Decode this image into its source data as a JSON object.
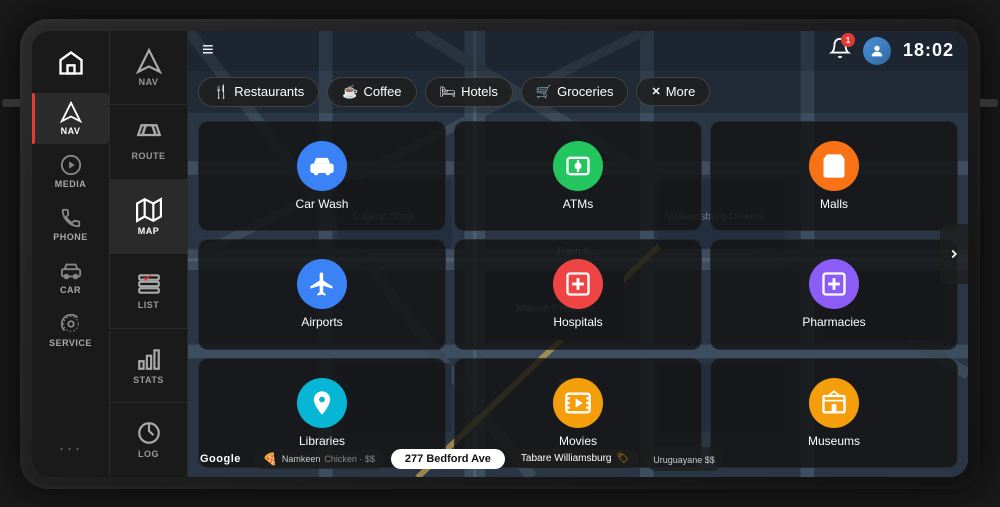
{
  "device": {
    "time": "18:02"
  },
  "sidebar": {
    "home_icon": "🏠",
    "items": [
      {
        "id": "nav",
        "label": "NAV",
        "icon": "nav",
        "active": true
      },
      {
        "id": "media",
        "label": "MEDIA",
        "icon": "media"
      },
      {
        "id": "phone",
        "label": "PHONE",
        "icon": "phone"
      },
      {
        "id": "car",
        "label": "CAR",
        "icon": "car"
      },
      {
        "id": "service",
        "label": "SERVICE",
        "icon": "service"
      }
    ],
    "dots": "···"
  },
  "nav_panel": {
    "items": [
      {
        "id": "nav",
        "label": "NAV",
        "active": false
      },
      {
        "id": "route",
        "label": "ROUTE",
        "active": false
      },
      {
        "id": "map",
        "label": "MAP",
        "active": true
      },
      {
        "id": "list",
        "label": "LIST",
        "active": false
      },
      {
        "id": "stats",
        "label": "STATS",
        "active": false
      },
      {
        "id": "log",
        "label": "LOG",
        "active": false
      }
    ]
  },
  "category_tabs": {
    "tabs": [
      {
        "id": "restaurants",
        "label": "Restaurants",
        "icon": "🍴"
      },
      {
        "id": "coffee",
        "label": "Coffee",
        "icon": "☕"
      },
      {
        "id": "hotels",
        "label": "Hotels",
        "icon": "🛏"
      },
      {
        "id": "groceries",
        "label": "Groceries",
        "icon": "🛒"
      },
      {
        "id": "more",
        "label": "More",
        "icon": "✕",
        "close": true
      }
    ]
  },
  "poi_grid": {
    "items": [
      {
        "id": "carwash",
        "label": "Car Wash",
        "icon": "🚗",
        "color": "#3b82f6"
      },
      {
        "id": "atms",
        "label": "ATMs",
        "icon": "💵",
        "color": "#22c55e"
      },
      {
        "id": "malls",
        "label": "Malls",
        "icon": "🛍",
        "color": "#f97316"
      },
      {
        "id": "airports",
        "label": "Airports",
        "icon": "✈",
        "color": "#3b82f6"
      },
      {
        "id": "hospitals",
        "label": "Hospitals",
        "icon": "🏥",
        "color": "#ef4444"
      },
      {
        "id": "pharmacies",
        "label": "Pharmacies",
        "icon": "💊",
        "color": "#8b5cf6"
      },
      {
        "id": "libraries",
        "label": "Libraries",
        "icon": "📚",
        "color": "#06b6d4"
      },
      {
        "id": "movies",
        "label": "Movies",
        "icon": "🎬",
        "color": "#f59e0b"
      },
      {
        "id": "museums",
        "label": "Museums",
        "icon": "🏛",
        "color": "#f59e0b"
      }
    ]
  },
  "bottom_bar": {
    "google_label": "Google",
    "address": "277 Bedford Ave",
    "place": "Tabare Williamsburg",
    "place_sub": "Uruguayane $$"
  },
  "notification_badge": "1",
  "hamburger": "≡"
}
